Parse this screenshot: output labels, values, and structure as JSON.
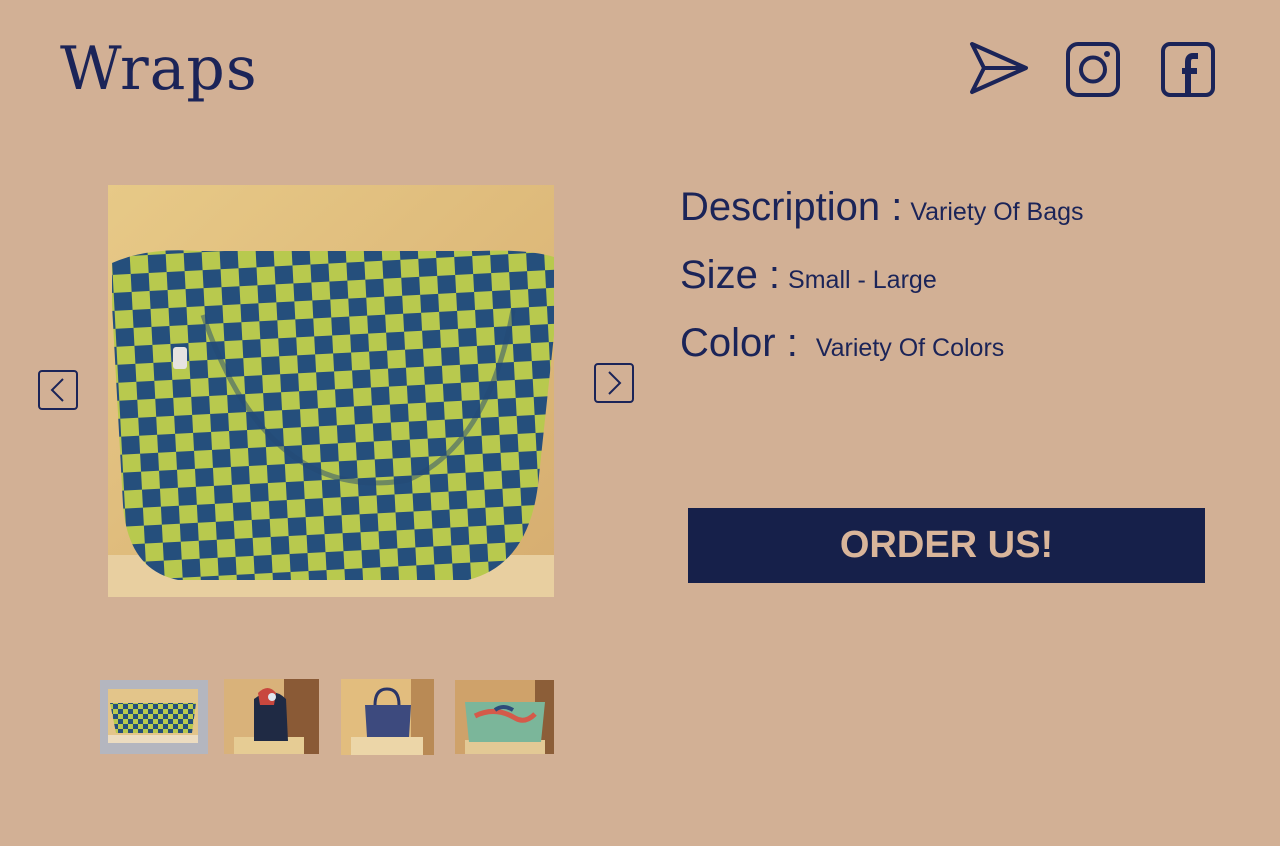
{
  "header": {
    "logo_text": "Wraps",
    "icons": [
      "send-icon",
      "instagram-icon",
      "facebook-icon"
    ]
  },
  "product": {
    "description_label": "Description :",
    "description_value": "Variety Of Bags",
    "size_label": "Size :",
    "size_value": "Small - Large",
    "color_label": "Color :",
    "color_value": "Variety Of Colors"
  },
  "order_button": {
    "label": "ORDER US!"
  },
  "gallery": {
    "selected_index": 0,
    "thumbnails": [
      {
        "name": "checkered-bag",
        "selected": true
      },
      {
        "name": "patterned-backpack",
        "selected": false
      },
      {
        "name": "navy-tote",
        "selected": false
      },
      {
        "name": "mint-tote",
        "selected": false
      }
    ]
  },
  "colors": {
    "background": "#d2b095",
    "primary": "#1b2458",
    "button_bg": "#16204a",
    "button_text": "#d9b59a",
    "thumb_selected_border": "#b4b6bf"
  }
}
